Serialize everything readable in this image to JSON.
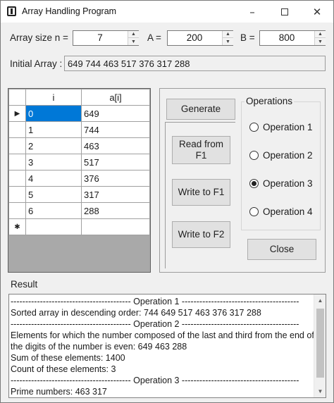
{
  "window": {
    "title": "Array Handling Program",
    "minimize": "–",
    "close": "✕"
  },
  "params": {
    "array_size_label": "Array size n =",
    "array_size_value": "7",
    "a_label": "A =",
    "a_value": "200",
    "b_label": "B =",
    "b_value": "800"
  },
  "initial": {
    "label": "Initial Array :",
    "value": "649 744 463 517 376 317 288"
  },
  "grid": {
    "columns": [
      "i",
      "a[i]"
    ],
    "rows": [
      {
        "i": "0",
        "v": "649"
      },
      {
        "i": "1",
        "v": "744"
      },
      {
        "i": "2",
        "v": "463"
      },
      {
        "i": "3",
        "v": "517"
      },
      {
        "i": "4",
        "v": "376"
      },
      {
        "i": "5",
        "v": "317"
      },
      {
        "i": "6",
        "v": "288"
      }
    ],
    "current_row_marker": "▶",
    "new_row_marker": "✱"
  },
  "buttons": {
    "generate": "Generate",
    "read_f1_line1": "Read from",
    "read_f1_line2": "F1",
    "write_f1": "Write to F1",
    "write_f2": "Write to F2",
    "close": "Close"
  },
  "operations": {
    "title": "Operations",
    "options": [
      "Operation 1",
      "Operation 2",
      "Operation 3",
      "Operation 4"
    ],
    "selected_index": 2
  },
  "result": {
    "label": "Result",
    "lines": [
      "----------------------------------------- Operation 1 ----------------------------------------",
      "Sorted array in descending order: 744 649 517 463 376 317 288",
      "----------------------------------------- Operation 2 ----------------------------------------",
      "Elements for which the number composed of the last and third from the end of",
      "the digits of the number is even: 649 463 288",
      "Sum of these elements: 1400",
      "Count of these elements: 3",
      "----------------------------------------- Operation 3 ----------------------------------------",
      "Prime numbers: 463 317"
    ]
  }
}
